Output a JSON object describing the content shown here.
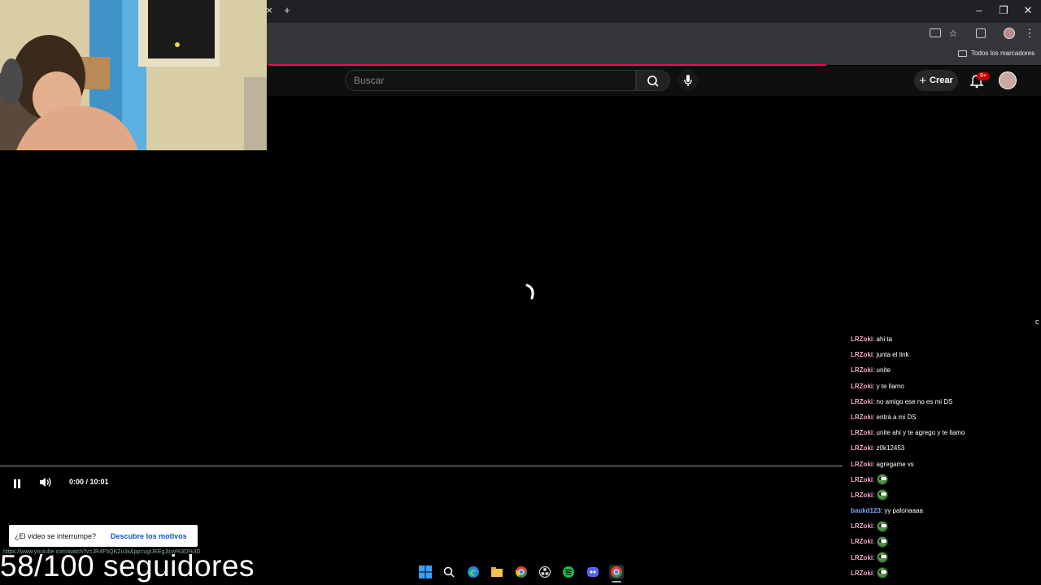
{
  "browser": {
    "new_tab_symbol": "+",
    "bookmarks_label": "Todos los marcadores",
    "win_controls": [
      "–",
      "❐",
      "✕"
    ]
  },
  "youtube": {
    "search_placeholder": "Buscar",
    "create_label": "Crear",
    "notification_count": "9+"
  },
  "player": {
    "time": "0:00 / 10:01",
    "accent_color": "#ff0050"
  },
  "toast": {
    "question": "¿El video se interrumpe?",
    "link": "Descubre los motivos"
  },
  "status_url": "https://www.youtube.com/watch?v=JR4F5QKZu3k&pp=ugUEEgJlcw%3D%3D",
  "overlay": {
    "followers": "58/100 seguidores"
  },
  "chat": {
    "messages": [
      {
        "user": "LRZoki",
        "text": ": ahi ta",
        "color": "#f4a7c5",
        "emote": false
      },
      {
        "user": "LRZoki",
        "text": ": junta el link",
        "color": "#f4a7c5",
        "emote": false
      },
      {
        "user": "LRZoki",
        "text": ": unite",
        "color": "#f4a7c5",
        "emote": false
      },
      {
        "user": "LRZoki",
        "text": ": y te llamo",
        "color": "#f4a7c5",
        "emote": false
      },
      {
        "user": "LRZoki",
        "text": ": no amigo ese no es mi DS",
        "color": "#f4a7c5",
        "emote": false
      },
      {
        "user": "LRZoki",
        "text": ": entrá a mi DS",
        "color": "#f4a7c5",
        "emote": false
      },
      {
        "user": "LRZoki",
        "text": ": unite ahi y te agrego y te llamo",
        "color": "#f4a7c5",
        "emote": false
      },
      {
        "user": "LRZoki",
        "text": ": z0k12453",
        "color": "#f4a7c5",
        "emote": false
      },
      {
        "user": "LRZoki",
        "text": ": agregame vs",
        "color": "#f4a7c5",
        "emote": false
      },
      {
        "user": "LRZoki",
        "text": ":",
        "color": "#f4a7c5",
        "emote": true
      },
      {
        "user": "LRZoki",
        "text": ":",
        "color": "#f4a7c5",
        "emote": true
      },
      {
        "user": "baukd123",
        "text": ": yy palonaaaa",
        "color": "#7fa8ff",
        "emote": false
      },
      {
        "user": "LRZoki",
        "text": ":",
        "color": "#f4a7c5",
        "emote": true
      },
      {
        "user": "LRZoki",
        "text": ":",
        "color": "#f4a7c5",
        "emote": true
      },
      {
        "user": "LRZoki",
        "text": ":",
        "color": "#f4a7c5",
        "emote": true
      },
      {
        "user": "LRZoki",
        "text": ":",
        "color": "#f4a7c5",
        "emote": true
      }
    ]
  },
  "taskbar": {
    "icons": [
      "windows-start-icon",
      "search-icon",
      "edge-icon",
      "file-explorer-icon",
      "chrome-icon",
      "obs-icon",
      "spotify-icon",
      "discord-icon",
      "chrome-profile-icon"
    ]
  }
}
